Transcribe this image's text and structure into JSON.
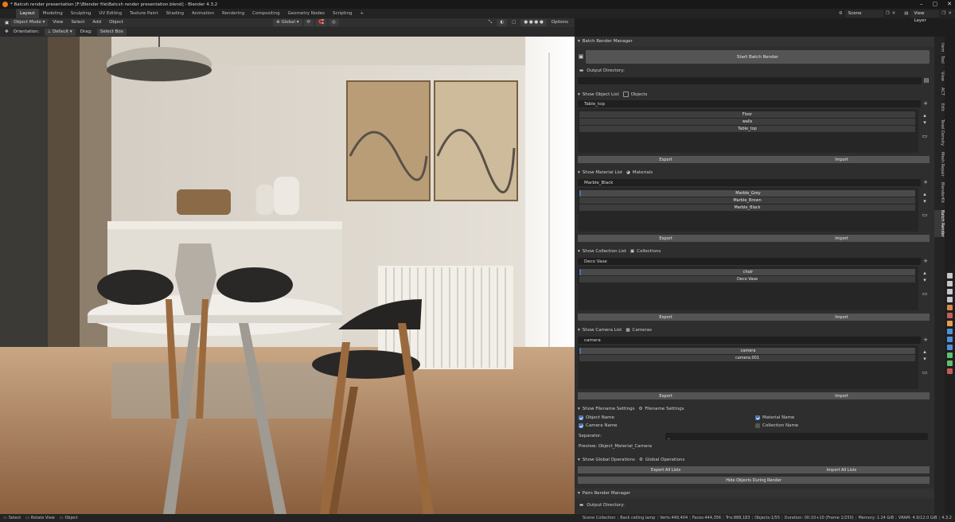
{
  "window": {
    "title": "* Batcsh render presentation [F:\\Blender file\\Batcsh render presentation.blend] - Blender 4.3.2"
  },
  "workspaces": [
    "Layout",
    "Modeling",
    "Sculpting",
    "UV Editing",
    "Texture Paint",
    "Shading",
    "Animation",
    "Rendering",
    "Compositing",
    "Geometry Nodes",
    "Scripting"
  ],
  "topbar": {
    "add": "+",
    "scene": "Scene",
    "view_layer": "View Layer"
  },
  "header1": {
    "mode": "Object Mode",
    "menus": [
      "View",
      "Select",
      "Add",
      "Object"
    ],
    "transform": "Global",
    "options": "Options"
  },
  "header2": {
    "orientation_label": "Orientation:",
    "orientation": "Default",
    "drag_label": "Drag:",
    "drag": "Select Box"
  },
  "sidebar_tabs": [
    "Item",
    "Tool",
    "View",
    "ACT",
    "Edit",
    "Texel Density",
    "Mesh Repair",
    "BlenderKit",
    "Batch Render"
  ],
  "panel": {
    "title": "Batch Render Manager",
    "start_button": "Start Batch Render",
    "output_label": "Output Directory:",
    "export_label": "Export",
    "import_label": "Import",
    "objects": {
      "show_label": "Show Object List",
      "type_label": "Objects",
      "filter": "Table_top",
      "items": [
        "Floor",
        "walls",
        "Table_top"
      ]
    },
    "materials": {
      "show_label": "Show Material List",
      "type_label": "Materials",
      "filter": "Marble_Black",
      "items": [
        "Marble_Grey",
        "Marble_Brown",
        "Marble_Black"
      ]
    },
    "collections": {
      "show_label": "Show Collection List",
      "type_label": "Collections",
      "filter": "Deco Vase",
      "items": [
        "chair",
        "Deco Vase"
      ]
    },
    "cameras": {
      "show_label": "Show Camera List",
      "type_label": "Cameras",
      "filter": "camera",
      "items": [
        "camera",
        "camera.001"
      ]
    },
    "filename": {
      "show_label": "Show Filename Settings",
      "type_label": "Filename Settings",
      "object_name": "Object Name",
      "material_name": "Material Name",
      "camera_name": "Camera Name",
      "collection_name": "Collection Name",
      "separator_label": "Separator:",
      "separator_value": "_",
      "preview": "Preview: Object_Material_Camera"
    },
    "global": {
      "show_label": "Show Global Operations",
      "type_label": "Global Operations",
      "export_all": "Export All Lists",
      "import_all": "Import All Lists",
      "hide_objects": "Hide Objects During Render"
    },
    "pairs": {
      "title": "Pairs Render Manager",
      "output_label": "Output Directory:"
    }
  },
  "status": {
    "select": "Select",
    "rotate": "Rotate View",
    "object": "Object",
    "info": [
      "Scene Collection",
      "Back ceiling lamp",
      "Verts:448,404",
      "Faces:444,356",
      "Tris:888,183",
      "Objects:1/55",
      "Duration: 00:10+10 (Frame 1/250)",
      "Memory: 1.24 GiB",
      "VRAM: 4.9/12.0 GiB",
      "4.3.2"
    ]
  },
  "colors": {
    "accent": "#4772b3",
    "panel_bg": "#2e2e2e",
    "button": "#545454",
    "field": "#1f1f1f"
  }
}
